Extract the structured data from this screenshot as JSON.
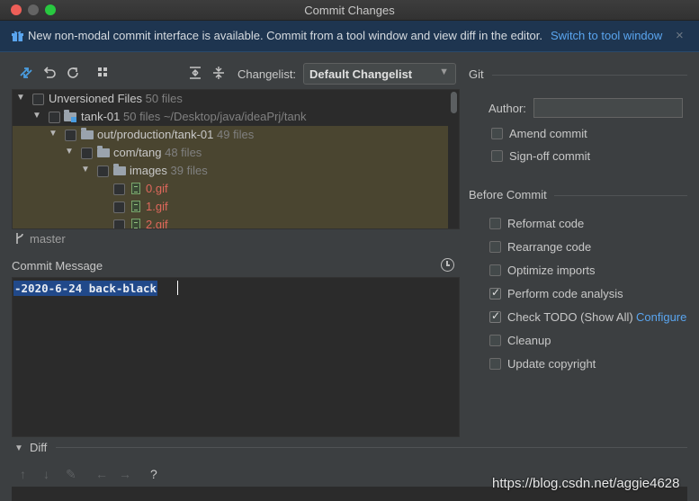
{
  "window": {
    "title": "Commit Changes"
  },
  "banner": {
    "icon": "gift-icon",
    "text": "New non-modal commit interface is available. Commit from a tool window and view diff in the editor.",
    "link": "Switch to tool window",
    "close": "×"
  },
  "toolbar": {
    "icons": [
      "show-diff-icon",
      "rollback-icon",
      "refresh-icon",
      "group-by-icon",
      "expand-all-icon",
      "collapse-all-icon"
    ],
    "changelist_label": "Changelist:",
    "changelist_value": "Default Changelist"
  },
  "tree": [
    {
      "label": "Unversioned Files",
      "count": "50 files",
      "extra": ""
    },
    {
      "label": "tank-01",
      "count": "50 files",
      "extra": "~/Desktop/java/ideaPrj/tank"
    },
    {
      "label": "out/production/tank-01",
      "count": "49 files",
      "extra": ""
    },
    {
      "label": "com/tang",
      "count": "48 files",
      "extra": ""
    },
    {
      "label": "images",
      "count": "39 files",
      "extra": ""
    },
    {
      "label": "0.gif"
    },
    {
      "label": "1.gif"
    },
    {
      "label": "2.gif"
    }
  ],
  "branch": "master",
  "commit": {
    "label": "Commit Message",
    "message": "-2020-6-24 back-black"
  },
  "diff": {
    "label": "Diff",
    "help": "?"
  },
  "git": {
    "heading": "Git",
    "author_label": "Author:",
    "author_value": "",
    "options": [
      {
        "label": "Amend commit",
        "checked": false
      },
      {
        "label": "Sign-off commit",
        "checked": false
      }
    ]
  },
  "before_commit": {
    "heading": "Before Commit",
    "options": [
      {
        "label": "Reformat code",
        "checked": false
      },
      {
        "label": "Rearrange code",
        "checked": false
      },
      {
        "label": "Optimize imports",
        "checked": false
      },
      {
        "label": "Perform code analysis",
        "checked": true
      },
      {
        "label": "Check TODO (Show All)",
        "checked": true
      },
      {
        "label": "Cleanup",
        "checked": false
      },
      {
        "label": "Update copyright",
        "checked": false
      }
    ],
    "configure_link": "Configure"
  },
  "watermark": "https://blog.csdn.net/aggie4628",
  "colors": {
    "accent_link": "#5aa5ef",
    "selection": "#21498a",
    "highlight_row": "#4a4530",
    "unversioned_file": "#e0685c"
  }
}
